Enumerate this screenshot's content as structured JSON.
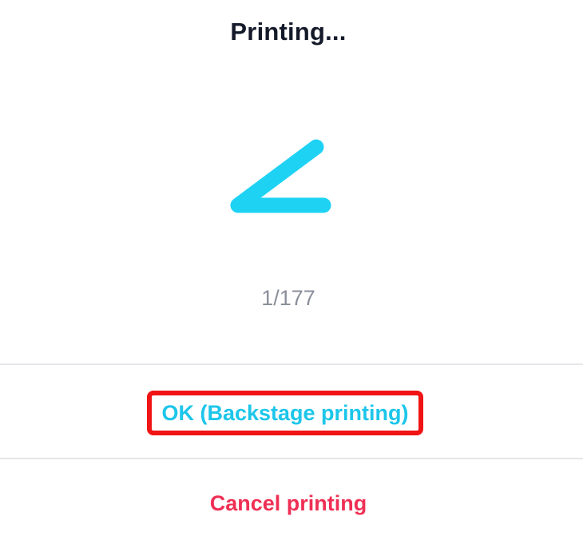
{
  "dialog": {
    "title": "Printing...",
    "progress_text": "1/177",
    "ok_label": "OK (Backstage printing)",
    "cancel_label": "Cancel printing"
  },
  "colors": {
    "title": "#141a2a",
    "spinner": "#1ed2f4",
    "progress": "#8a8f9a",
    "ok": "#1cc6ea",
    "highlight_border": "#f01414",
    "cancel": "#ef2f55",
    "divider": "#e6e7ea"
  },
  "icons": {
    "spinner": "loading-spinner-icon"
  }
}
